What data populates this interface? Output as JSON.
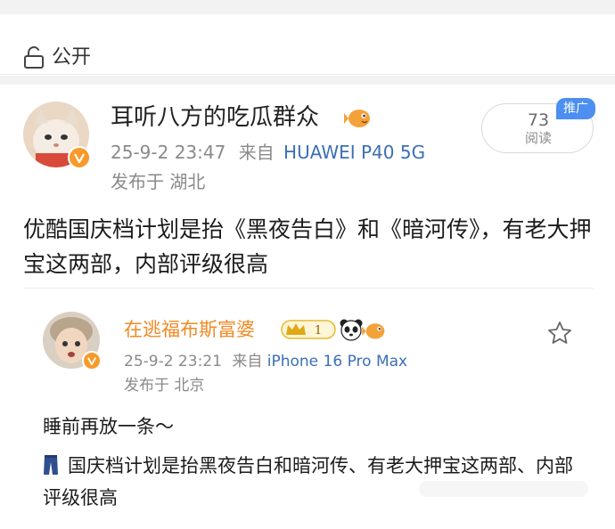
{
  "visibility": {
    "label": "公开"
  },
  "post": {
    "author": "耳听八方的吃瓜群众",
    "time": "25-9-2 23:47",
    "source_prefix": "来自",
    "device": "HUAWEI P40 5G",
    "location": "发布于 湖北",
    "views_count": "73",
    "views_label": "阅读",
    "promo_badge": "推广",
    "text": "优酷国庆档计划是抬《黑夜告白》和《暗河传》，有老大押宝这两部，内部评级很高"
  },
  "repost": {
    "author": "在逃福布斯富婆",
    "crown_level": "1",
    "time": "25-9-2 23:21",
    "source_prefix": "来自",
    "device": "iPhone 16 Pro Max",
    "location": "发布于 北京",
    "line1": "睡前再放一条～",
    "line2": "国庆档计划是抬黑夜告白和暗河传、有老大押宝这两部、内部评级很高"
  },
  "colors": {
    "accent_orange": "#f08a24",
    "device_blue": "#3c6fb6",
    "promo_blue": "#4c8ff0",
    "verified_badge": "#f79a2a"
  },
  "icons": {
    "visibility": "lock-open-icon",
    "verified": "verified-v-icon",
    "emoji": "pufferfish-icon",
    "panda": "panda-icon",
    "favorite": "star-icon",
    "jeans": "jeans-icon"
  }
}
